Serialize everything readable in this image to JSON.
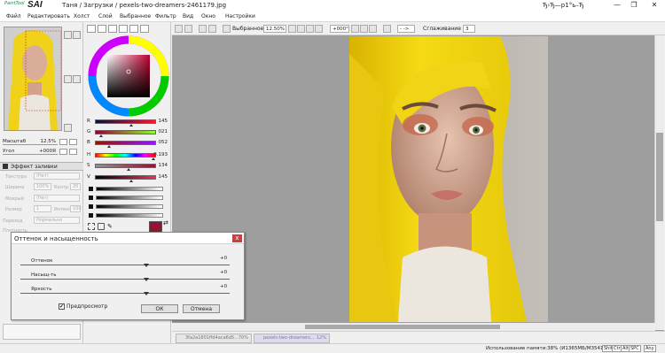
{
  "app": {
    "logo_small": "PaintTool",
    "logo_big": "SAI",
    "title": "Таня / Загрузки / pexels-two-dreamers-2461179.jpg",
    "user": "Ђ›Ђ—р1°ь–Ђ"
  },
  "window": {
    "minimize": "—",
    "maximize": "❐",
    "close": "✕"
  },
  "menu": [
    "Файл",
    "Редактировать",
    "Холст",
    "Слой",
    "Выбранное",
    "Фильтр",
    "Вид",
    "Окно",
    "Настройки"
  ],
  "navigator": {
    "zoom_label": "Масштаб",
    "zoom_value": "12.5%",
    "angle_label": "Угол",
    "angle_value": "+000Я"
  },
  "effect": {
    "header": "Эффект заливки",
    "texture_label": "Текстура",
    "texture_value": "(Нет)",
    "width_label": "Ширина",
    "width_value": "100%",
    "contrast_label": "Контр.",
    "contrast_value": "20",
    "wet_label": "Мокрый",
    "wet_value": "(Нет)",
    "size_label": "Размер",
    "size_value": "1",
    "intensity_label": "Интенс.",
    "intensity_value": "100",
    "transition_label": "Переход",
    "transition_value": "Нормально",
    "density_label": "Плотность"
  },
  "color": {
    "R": {
      "label": "R",
      "value": "145"
    },
    "G": {
      "label": "G",
      "value": "021"
    },
    "B": {
      "label": "B",
      "value": "052"
    },
    "H": {
      "label": "H",
      "value": "0.193"
    },
    "S": {
      "label": "S",
      "value": "134"
    },
    "V": {
      "label": "V",
      "value": "145"
    },
    "current": "#911534"
  },
  "toolbar": {
    "selection_label": "Выбранное",
    "zoom_value": "12.50%",
    "angle_value": "+000°",
    "arrow_value": "- ->",
    "smoothing_label": "Сглаживание",
    "smoothing_value": "3"
  },
  "filetabs": [
    {
      "name": "3fa2a1801ffd4aca6d5...",
      "zoom": "70%"
    },
    {
      "name": "pexels-two-dreamers...",
      "zoom": "12%"
    }
  ],
  "status": {
    "memory": "Использование памяти:38% (И1365МБ/М3541МБ)",
    "buttons": [
      "Shift",
      "Ctrl",
      "Alt",
      "SPC",
      "Any"
    ]
  },
  "dialog": {
    "title": "Оттенок и насыщенность",
    "close": "x",
    "sliders": [
      {
        "label": "Оттенок",
        "value": "+0"
      },
      {
        "label": "Насыщ-ть",
        "value": "+0"
      },
      {
        "label": "Яркость",
        "value": "+0"
      }
    ],
    "preview_label": "Предпросмотр",
    "preview_checked": "✔",
    "ok": "ОК",
    "cancel": "Отмена"
  }
}
